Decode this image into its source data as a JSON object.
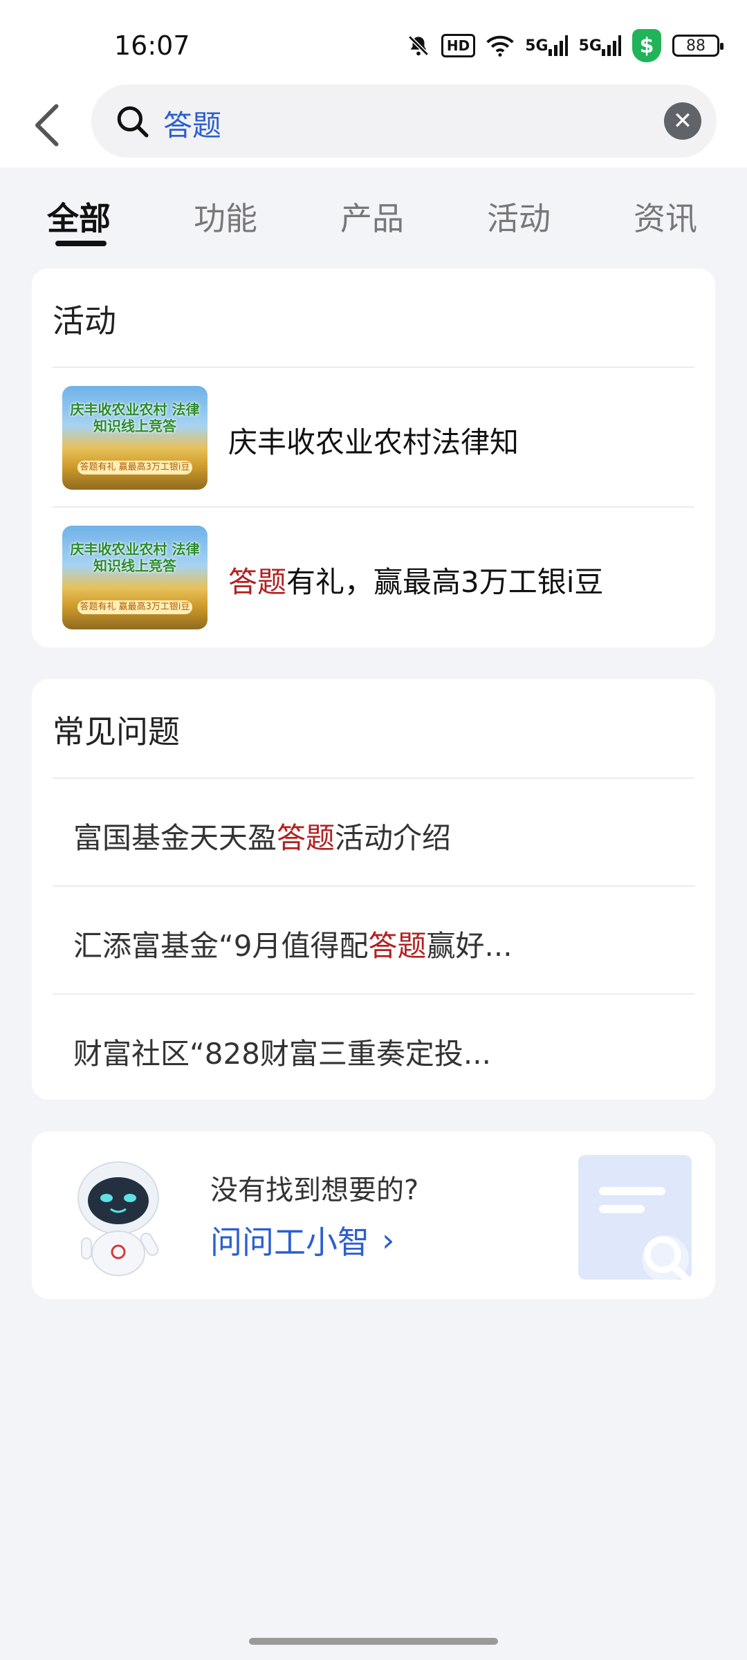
{
  "status_bar": {
    "time": "16:07",
    "hd_label": "HD",
    "signal1": "5G",
    "signal2": "5G",
    "shield_symbol": "$",
    "battery": "88"
  },
  "search": {
    "query": "答题",
    "clear_symbol": "✕"
  },
  "tabs": [
    {
      "label": "全部",
      "active": true
    },
    {
      "label": "功能",
      "active": false
    },
    {
      "label": "产品",
      "active": false
    },
    {
      "label": "活动",
      "active": false
    },
    {
      "label": "资讯",
      "active": false
    }
  ],
  "activity_section": {
    "title": "活动",
    "items": [
      {
        "thumb_text": "庆丰收农业农村 法律知识线上竞答",
        "thumb_badge": "答题有礼 赢最高3万工银i豆",
        "title": "庆丰收农业农村法律知"
      },
      {
        "thumb_text": "庆丰收农业农村 法律知识线上竞答",
        "thumb_badge": "答题有礼 赢最高3万工银i豆",
        "title_highlight": "答题",
        "title_rest": "有礼，赢最高3万工银i豆"
      }
    ]
  },
  "faq_section": {
    "title": "常见问题",
    "items": [
      {
        "before": "富国基金天天盈",
        "highlight": "答题",
        "after": "活动介绍"
      },
      {
        "before": "汇添富基金“9月值得配",
        "highlight": "答题",
        "after": "赢好..."
      },
      {
        "before": "财富社区“828财富三重奏定投...",
        "highlight": "",
        "after": ""
      }
    ]
  },
  "help_card": {
    "question": "没有找到想要的?",
    "link": "问问工小智",
    "link_arrow": "›"
  },
  "colors": {
    "accent_blue": "#2c5fcf",
    "highlight_red": "#b32020",
    "background": "#f3f4f8"
  },
  "icons": [
    "back-chevron-icon",
    "search-icon",
    "clear-icon",
    "robot-mascot-icon",
    "document-search-icon"
  ]
}
